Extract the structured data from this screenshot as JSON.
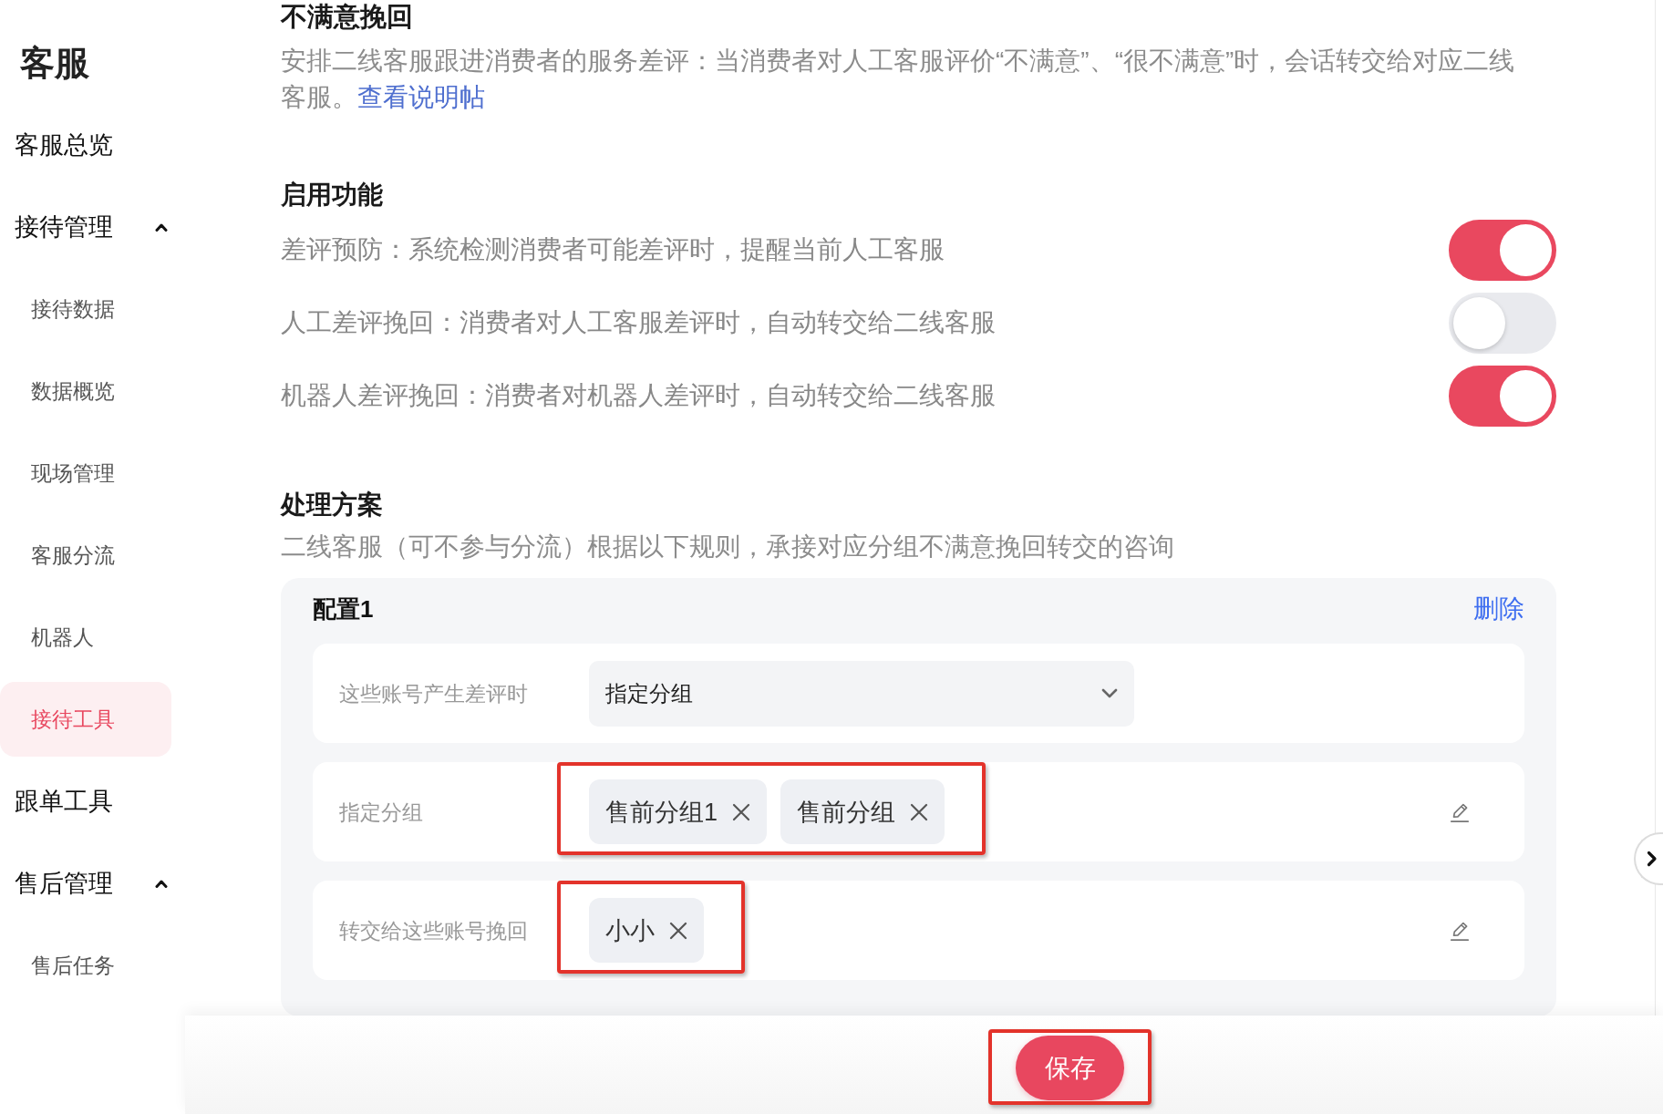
{
  "sidebar": {
    "title": "客服",
    "items": [
      {
        "kind": "link",
        "label": "客服总览",
        "selected": false
      },
      {
        "kind": "group",
        "label": "接待管理",
        "expanded": true,
        "children": [
          {
            "label": "接待数据",
            "selected": false
          },
          {
            "label": "数据概览",
            "selected": false
          },
          {
            "label": "现场管理",
            "selected": false
          },
          {
            "label": "客服分流",
            "selected": false
          },
          {
            "label": "机器人",
            "selected": false
          },
          {
            "label": "接待工具",
            "selected": true
          }
        ]
      },
      {
        "kind": "link",
        "label": "跟单工具",
        "selected": false
      },
      {
        "kind": "group",
        "label": "售后管理",
        "expanded": true,
        "children": [
          {
            "label": "售后任务",
            "selected": false
          }
        ]
      }
    ]
  },
  "section": {
    "title": "不满意挽回",
    "description": "安排二线客服跟进消费者的服务差评：当消费者对人工客服评价“不满意”、“很不满意”时，会话转交给对应二线客服。",
    "link": "查看说明帖"
  },
  "features": {
    "title": "启用功能",
    "items": [
      {
        "label": "差评预防：系统检测消费者可能差评时，提醒当前人工客服",
        "on": true
      },
      {
        "label": "人工差评挽回：消费者对人工客服差评时，自动转交给二线客服",
        "on": false
      },
      {
        "label": "机器人差评挽回：消费者对机器人差评时，自动转交给二线客服",
        "on": true
      }
    ]
  },
  "plan": {
    "title": "处理方案",
    "description": "二线客服（可不参与分流）根据以下规则，承接对应分组不满意挽回转交的咨询",
    "configs": [
      {
        "title": "配置1",
        "delete_label": "删除",
        "fields": [
          {
            "kind": "select",
            "label": "这些账号产生差评时",
            "value": "指定分组",
            "highlighted": false
          },
          {
            "kind": "tags",
            "label": "指定分组",
            "tags": [
              "售前分组1",
              "售前分组"
            ],
            "highlighted": true
          },
          {
            "kind": "tags",
            "label": "转交给这些账号挽回",
            "tags": [
              "小小"
            ],
            "highlighted": true
          }
        ]
      }
    ]
  },
  "footer": {
    "save_label": "保存",
    "save_highlighted": true
  }
}
